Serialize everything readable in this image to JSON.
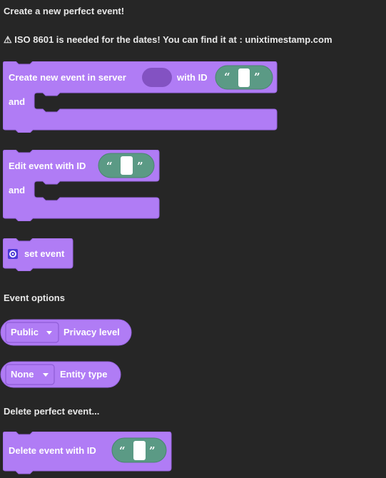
{
  "headings": {
    "create_title": "Create a new perfect event!",
    "iso_warning": "⚠ ISO 8601 is needed for the dates! You can find it at : unixtimestamp.com",
    "event_options": "Event options",
    "delete_title": "Delete perfect event..."
  },
  "blocks": {
    "create": {
      "label": "Create new event in server",
      "with_id": "with ID",
      "and": "and"
    },
    "edit": {
      "label": "Edit event with ID",
      "and": "and"
    },
    "set_event": {
      "label": "set event"
    },
    "privacy": {
      "value": "Public",
      "label": "Privacy level"
    },
    "entity": {
      "value": "None",
      "label": "Entity type"
    },
    "delete": {
      "label": "Delete event with ID"
    }
  },
  "quote_open": "“",
  "quote_close": "”",
  "colors": {
    "background": "#262626",
    "block_purple": "#b07cf5",
    "block_border": "#8e5cd6",
    "string_green": "#5b9a85",
    "slot_purple": "#8352c2"
  }
}
